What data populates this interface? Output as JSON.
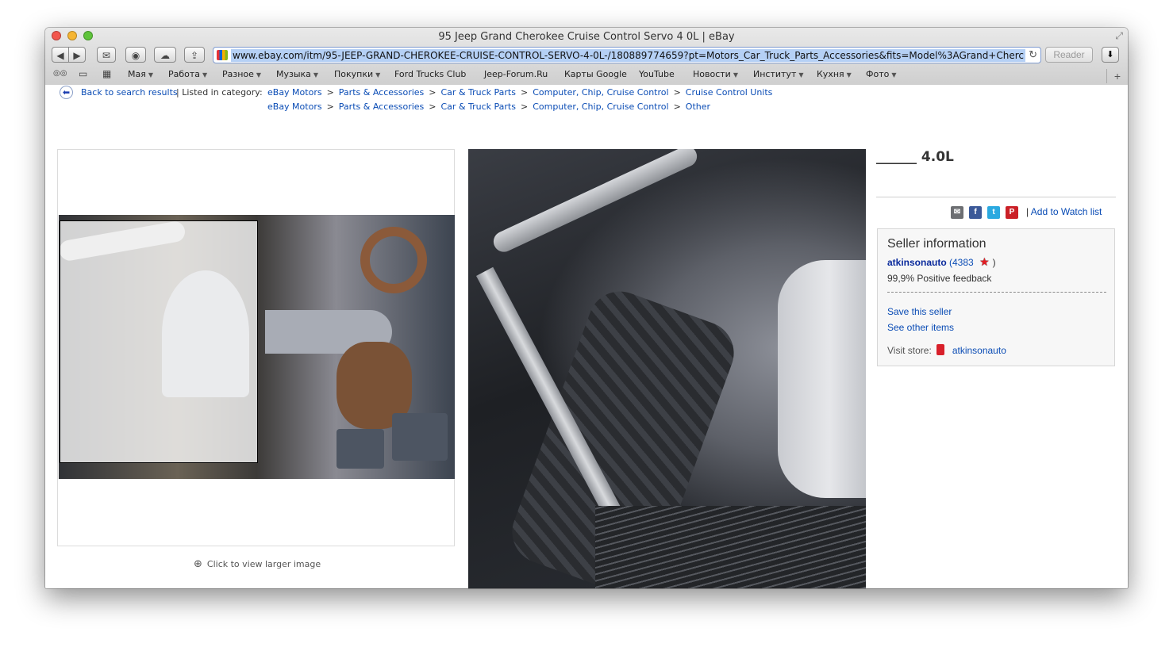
{
  "window": {
    "title": "95 Jeep Grand Cherokee Cruise Control Servo 4 0L | eBay"
  },
  "toolbar": {
    "back_label": "◀",
    "forward_label": "▶",
    "mail_label": "✉",
    "top_sites_label": "◉",
    "icloud_label": "☁",
    "share_label": "⇪",
    "reader_label": "Reader",
    "downloads_label": "⬇",
    "reload_label": "↻"
  },
  "address": {
    "url": "www.ebay.com/itm/95-JEEP-GRAND-CHEROKEE-CRUISE-CONTROL-SERVO-4-0L-/180889774659?pt=Motors_Car_Truck_Parts_Accessories&fits=Model%3AGrand+Cherc"
  },
  "bookmarks": {
    "reading_list_icon": "◎◎",
    "bookmarks_icon": "▭",
    "grid_icon": "▦",
    "items": [
      {
        "label": "Мая",
        "menu": true
      },
      {
        "label": "Работа",
        "menu": true
      },
      {
        "label": "Разное",
        "menu": true
      },
      {
        "label": "Музыка",
        "menu": true
      },
      {
        "label": "Покупки",
        "menu": true
      },
      {
        "label": "Ford Trucks Club",
        "menu": false
      },
      {
        "label": "Jeep-Forum.Ru",
        "menu": false
      },
      {
        "label": "Карты Google",
        "menu": false
      },
      {
        "label": "YouTube",
        "menu": false
      },
      {
        "label": "Новости",
        "menu": true
      },
      {
        "label": "Институт",
        "menu": true
      },
      {
        "label": "Кухня",
        "menu": true
      },
      {
        "label": "Фото",
        "menu": true
      }
    ],
    "menu_arrow": "▼",
    "new_tab": "+"
  },
  "breadcrumbs": {
    "back_text": "Back to search results",
    "listed_label": "| Listed in category:",
    "separator": ">",
    "row1": [
      "eBay Motors",
      "Parts & Accessories",
      "Car & Truck Parts",
      "Computer, Chip, Cruise Control",
      "Cruise Control Units"
    ],
    "row2": [
      "eBay Motors",
      "Parts & Accessories",
      "Car & Truck Parts",
      "Computer, Chip, Cruise Control",
      "Other"
    ]
  },
  "gallery": {
    "zoom_caption": "Click to view larger image"
  },
  "item": {
    "title": "______ 4.0L"
  },
  "share": {
    "email_icon": "✉",
    "facebook_icon": "f",
    "twitter_icon": "t",
    "pinterest_icon": "P",
    "divider": "|",
    "watch_label": "Add to Watch list"
  },
  "seller": {
    "heading": "Seller information",
    "name": "atkinsonauto",
    "score": "(4383",
    "score_close": ")",
    "star_icon": "★",
    "feedback": "99,9% Positive feedback",
    "save_seller": "Save this seller",
    "other_items": "See other items",
    "visit_label": "Visit store:",
    "store_name": "atkinsonauto"
  },
  "colors": {
    "link": "#0a4cb5",
    "seller_name": "#0a2a9c",
    "facebook": "#3b5998",
    "twitter": "#2aa9e0",
    "pinterest": "#cb2027",
    "star": "#e41c23"
  }
}
